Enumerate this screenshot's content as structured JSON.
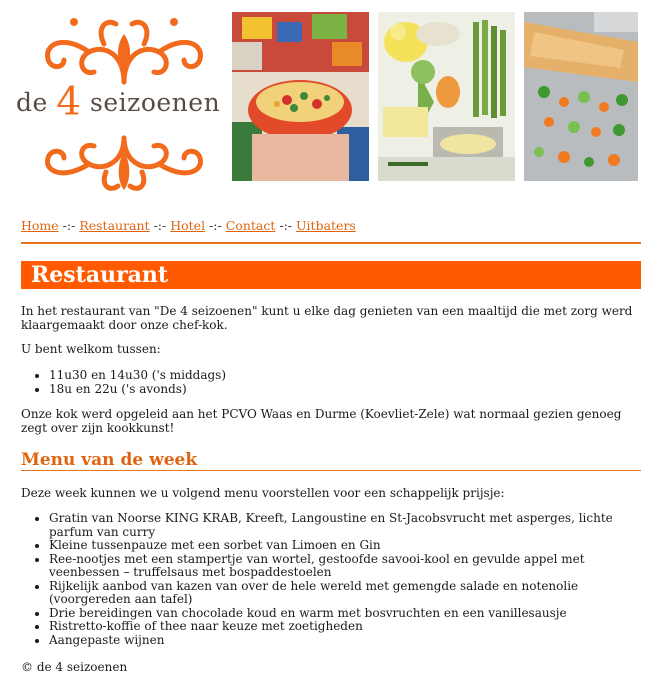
{
  "brand": {
    "prefix": "de",
    "number": "4",
    "suffix": "seizoenen",
    "accent_color": "#ff5a00"
  },
  "nav": {
    "items": [
      "Home",
      "Restaurant",
      "Hotel",
      "Contact",
      "Uitbaters"
    ],
    "separator": "-:-"
  },
  "page": {
    "title": "Restaurant",
    "intro": "In het restaurant van \"De 4 seizoenen\" kunt u elke dag genieten van een maaltijd die met zorg werd klaargemaakt door onze chef-kok.",
    "welcome": "U bent welkom tussen:",
    "times": [
      "11u30 en 14u30 ('s middags)",
      "18u en 22u ('s avonds)"
    ],
    "cook": "Onze kok werd opgeleid aan het PCVO Waas en Durme (Koevliet-Zele) wat normaal gezien genoeg zegt over zijn kookkunst!"
  },
  "menu": {
    "title": "Menu van de week",
    "intro": "Deze week kunnen we u volgend menu voorstellen voor een schappelijk prijsje:",
    "items": [
      "Gratin van Noorse KING KRAB, Kreeft, Langoustine en St-Jacobsvrucht met asperges, lichte parfum van curry",
      "Kleine tussenpauze met een sorbet van Limoen en Gin",
      "Ree-nootjes met een stampertje van wortel, gestoofde savooi-kool en gevulde appel met veenbessen – truffelsaus met bospaddestoelen",
      "Rijkelijk aanbod van kazen van over de hele wereld met gemengde salade en notenolie (voorgereden aan tafel)",
      "Drie bereidingen van chocolade koud en warm met bosvruchten en een vanillesausje",
      "Ristretto-koffie of thee naar keuze met zoetigheden",
      "Aangepaste wijnen"
    ]
  },
  "footer": {
    "text": "© de 4 seizoenen"
  }
}
